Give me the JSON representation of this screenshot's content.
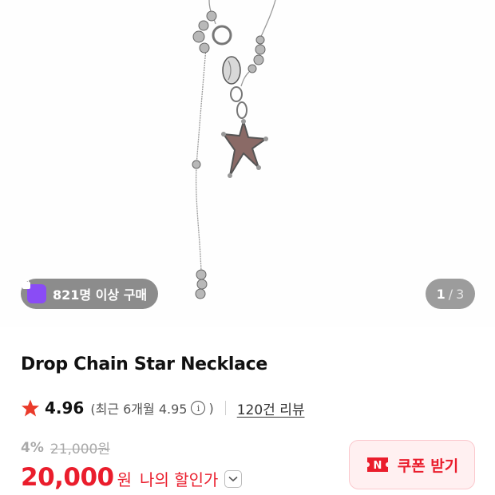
{
  "product": {
    "title": "Drop Chain Star Necklace"
  },
  "gallery": {
    "image_alt": "Drop Chain Star Necklace",
    "purchase_badge": "821명 이상 구매",
    "pager": {
      "current": "1",
      "separator": "/",
      "total": "3"
    }
  },
  "rating": {
    "score": "4.96",
    "recent_open": "(최근 6개월 4.95",
    "recent_close": ")",
    "reviews": "120건 리뷰"
  },
  "price": {
    "discount_percent": "4%",
    "original": "21,000원",
    "sale": "20,000",
    "currency": "원",
    "label": "나의 할인가"
  },
  "coupon": {
    "label": "쿠폰 받기",
    "icon_text": "N"
  },
  "colors": {
    "accent_red": "#ea1d2c",
    "star": "#ea3b2b",
    "badge_icon": "#8a4cf5",
    "coupon_bg": "#fff0f1"
  }
}
